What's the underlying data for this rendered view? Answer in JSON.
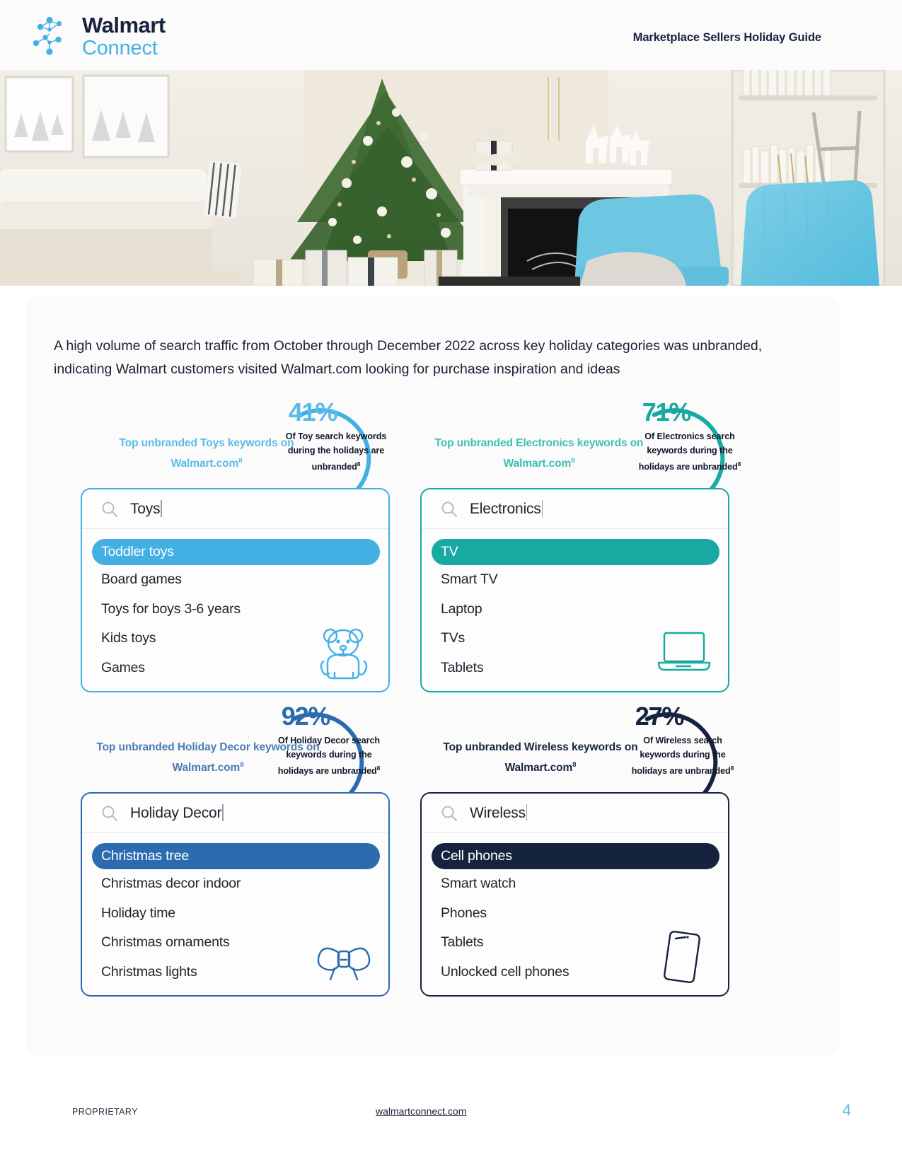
{
  "header": {
    "logo_brand": "Walmart",
    "logo_sub": "Connect",
    "logo_mark_icon": "walmart-connect-spark-icon",
    "title": "Marketplace Sellers Holiday Guide"
  },
  "hero": {
    "alt": "Holiday living room with decorated Christmas tree, fireplace and blue armchair",
    "icon": "holiday-living-room-photo"
  },
  "main": {
    "intro": "A high volume of search traffic from October through December 2022 across key holiday categories was unbranded, indicating Walmart customers visited Walmart.com looking for purchase inspiration and ideas",
    "footnote_marker": "8"
  },
  "quadrants": [
    {
      "id": "toys",
      "caption": "Top unbranded Toys keywords on Walmart.com",
      "caption_sup": "8",
      "stat_value": "41%",
      "stat_desc": "Of Toy search keywords during the holidays are unbranded",
      "stat_desc_sup": "8",
      "search_value": "Toys",
      "search_icon": "search-icon",
      "decor_icon": "teddy-bear-icon",
      "accent": "#43b0e4",
      "pct_color": "#5bbbe8",
      "suggestions": [
        {
          "label": "Toddler toys",
          "selected": true
        },
        {
          "label": "Board games",
          "selected": false
        },
        {
          "label": "Toys for boys 3-6 years",
          "selected": false
        },
        {
          "label": "Kids toys",
          "selected": false
        },
        {
          "label": "Games",
          "selected": false
        }
      ]
    },
    {
      "id": "electronics",
      "caption": "Top unbranded Electronics keywords on Walmart.com",
      "caption_sup": "8",
      "stat_value": "71%",
      "stat_desc": "Of Electronics search keywords during the holidays are unbranded",
      "stat_desc_sup": "8",
      "search_value": "Electronics",
      "search_icon": "search-icon",
      "decor_icon": "laptop-icon",
      "accent": "#17a9a2",
      "pct_color": "#17a9a2",
      "suggestions": [
        {
          "label": "TV",
          "selected": true
        },
        {
          "label": "Smart TV",
          "selected": false
        },
        {
          "label": "Laptop",
          "selected": false
        },
        {
          "label": "TVs",
          "selected": false
        },
        {
          "label": "Tablets",
          "selected": false
        }
      ]
    },
    {
      "id": "holiday-decor",
      "caption": "Top unbranded Holiday Decor keywords on Walmart.com",
      "caption_sup": "8",
      "stat_value": "92%",
      "stat_desc": "Of Holiday Decor search keywords during the holidays are unbranded",
      "stat_desc_sup": "8",
      "search_value": "Holiday Decor",
      "search_icon": "search-icon",
      "decor_icon": "ribbon-bow-icon",
      "accent": "#2c6bb0",
      "pct_color": "#2c6bb0",
      "suggestions": [
        {
          "label": "Christmas tree",
          "selected": true
        },
        {
          "label": "Christmas decor indoor",
          "selected": false
        },
        {
          "label": "Holiday time",
          "selected": false
        },
        {
          "label": "Christmas ornaments",
          "selected": false
        },
        {
          "label": "Christmas lights",
          "selected": false
        }
      ]
    },
    {
      "id": "wireless",
      "caption": "Top unbranded Wireless keywords on Walmart.com",
      "caption_sup": "8",
      "stat_value": "27%",
      "stat_desc": "Of Wireless search keywords during the holidays are unbranded",
      "stat_desc_sup": "8",
      "search_value": "Wireless",
      "search_icon": "search-icon",
      "decor_icon": "smartphone-icon",
      "accent": "#16233f",
      "pct_color": "#16233f",
      "suggestions": [
        {
          "label": "Cell phones",
          "selected": true
        },
        {
          "label": "Smart watch",
          "selected": false
        },
        {
          "label": "Phones",
          "selected": false
        },
        {
          "label": "Tablets",
          "selected": false
        },
        {
          "label": "Unlocked cell phones",
          "selected": false
        }
      ]
    }
  ],
  "footer": {
    "proprietary": "PROPRIETARY",
    "url": "walmartconnect.com",
    "page_number": "4",
    "page_number_color": "#56b9e8"
  }
}
